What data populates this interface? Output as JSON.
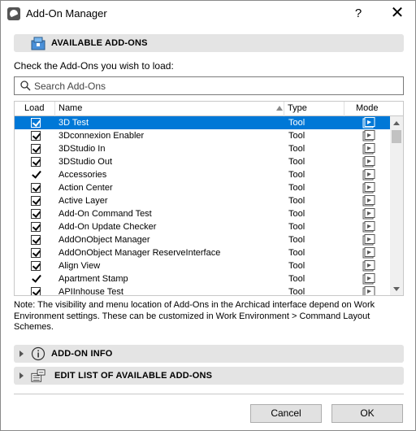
{
  "window": {
    "title": "Add-On Manager",
    "help_label": "?",
    "close_label": "✕"
  },
  "available_section": {
    "label": "AVAILABLE ADD-ONS",
    "instruction": "Check the Add-Ons you wish to load:"
  },
  "search": {
    "placeholder": "Search Add-Ons",
    "value": ""
  },
  "list": {
    "columns": {
      "load": "Load",
      "name": "Name",
      "type": "Type",
      "mode": "Mode"
    },
    "rows": [
      {
        "name": "3D Test",
        "type": "Tool",
        "load": "checkbox",
        "selected": true
      },
      {
        "name": "3Dconnexion Enabler",
        "type": "Tool",
        "load": "checkbox",
        "selected": false
      },
      {
        "name": "3DStudio In",
        "type": "Tool",
        "load": "checkbox",
        "selected": false
      },
      {
        "name": "3DStudio Out",
        "type": "Tool",
        "load": "checkbox",
        "selected": false
      },
      {
        "name": "Accessories",
        "type": "Tool",
        "load": "tick",
        "selected": false
      },
      {
        "name": "Action Center",
        "type": "Tool",
        "load": "checkbox",
        "selected": false
      },
      {
        "name": "Active Layer",
        "type": "Tool",
        "load": "checkbox",
        "selected": false
      },
      {
        "name": "Add-On Command Test",
        "type": "Tool",
        "load": "checkbox",
        "selected": false
      },
      {
        "name": "Add-On Update Checker",
        "type": "Tool",
        "load": "checkbox",
        "selected": false
      },
      {
        "name": "AddOnObject Manager",
        "type": "Tool",
        "load": "checkbox",
        "selected": false
      },
      {
        "name": "AddOnObject Manager ReserveInterface",
        "type": "Tool",
        "load": "checkbox",
        "selected": false
      },
      {
        "name": "Align View",
        "type": "Tool",
        "load": "checkbox",
        "selected": false
      },
      {
        "name": "Apartment Stamp",
        "type": "Tool",
        "load": "tick",
        "selected": false
      },
      {
        "name": "APIInhouse Test",
        "type": "Tool",
        "load": "checkbox",
        "selected": false
      }
    ]
  },
  "note": "Note: The visibility and menu location of Add-Ons in the Archicad interface depend on Work Environment settings. These can be customized in Work Environment > Command Layout Schemes.",
  "sections": {
    "addon_info": "ADD-ON INFO",
    "edit_list": "EDIT LIST OF AVAILABLE ADD-ONS"
  },
  "buttons": {
    "cancel": "Cancel",
    "ok": "OK"
  },
  "colors": {
    "selection": "#0078d7",
    "section_bar": "#e4e4e4",
    "button_face": "#e1e1e1"
  }
}
